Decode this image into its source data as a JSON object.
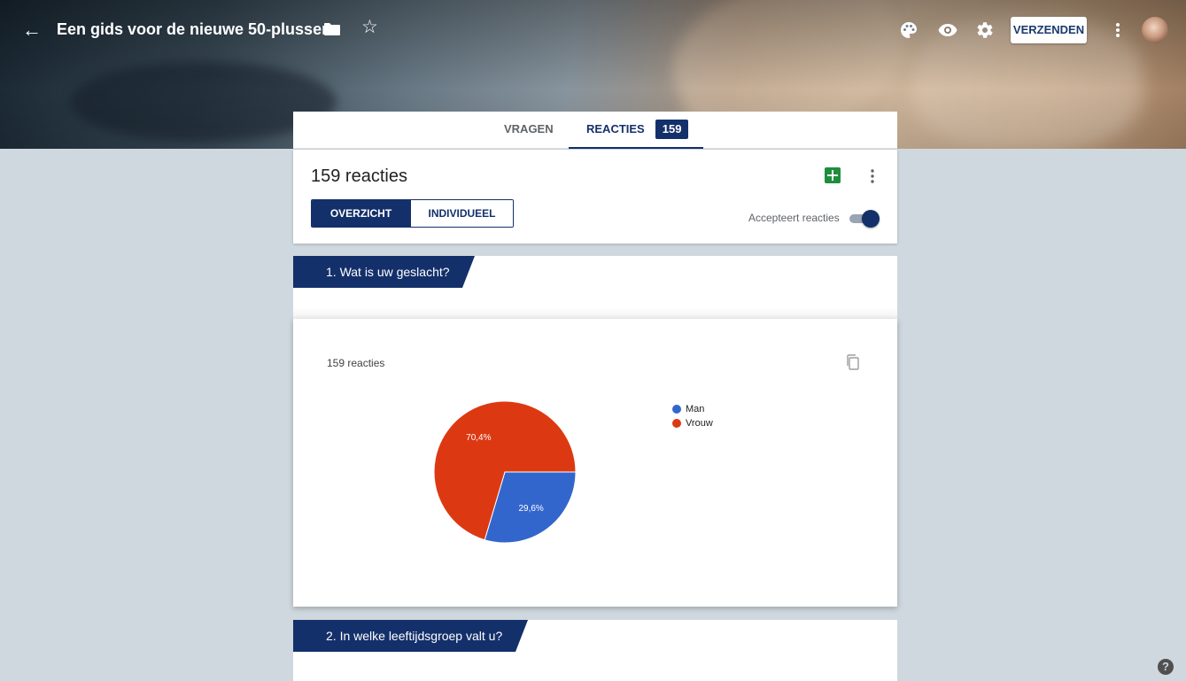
{
  "header": {
    "form_title": "Een gids voor de nieuwe 50-plusser",
    "send_label": "VERZENDEN"
  },
  "tabs": {
    "questions_label": "VRAGEN",
    "responses_label": "REACTIES",
    "responses_badge": "159"
  },
  "summary": {
    "title": "159 reacties",
    "view_overview": "OVERZICHT",
    "view_individual": "INDIVIDUEEL",
    "accepting_label": "Accepteert reacties",
    "accepting_on": true
  },
  "questions": [
    {
      "label": "1. Wat is uw geslacht?",
      "response_count": "159 reacties",
      "chart_data": {
        "type": "pie",
        "categories": [
          "Man",
          "Vrouw"
        ],
        "values": [
          29.6,
          70.4
        ],
        "value_labels": [
          "29,6%",
          "70,4%"
        ],
        "colors": [
          "#3366cc",
          "#dc3912"
        ],
        "legend_position": "right"
      }
    },
    {
      "label": "2. In welke leeftijdsgroep valt u?"
    }
  ],
  "icons": {
    "back": "arrow-back-icon",
    "folder": "folder-icon",
    "star": "star-icon",
    "palette": "palette-icon",
    "preview": "eye-icon",
    "settings": "gear-icon",
    "more": "more-vert-icon",
    "sheets": "sheets-icon",
    "copy": "copy-icon",
    "help": "help-icon"
  }
}
